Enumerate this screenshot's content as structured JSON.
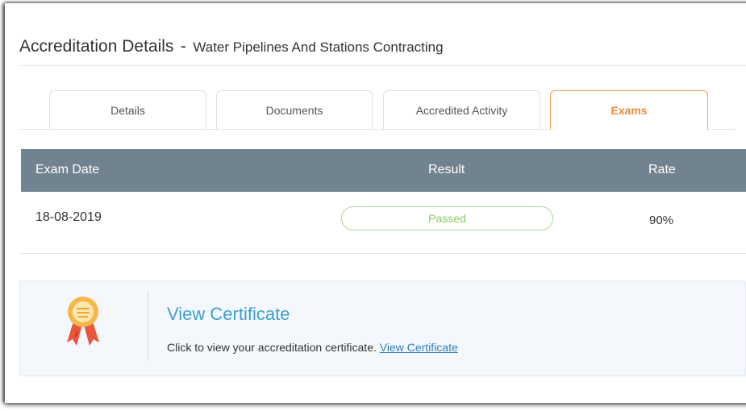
{
  "header": {
    "title": "Accreditation Details",
    "separator": "-",
    "subtitle": "Water Pipelines And Stations Contracting"
  },
  "tabs": [
    {
      "label": "Details",
      "active": false
    },
    {
      "label": "Documents",
      "active": false
    },
    {
      "label": "Accredited Activity",
      "active": false
    },
    {
      "label": "Exams",
      "active": true
    }
  ],
  "exams_table": {
    "columns": [
      "Exam Date",
      "Result",
      "Rate"
    ],
    "rows": [
      {
        "exam_date": "18-08-2019",
        "result": "Passed",
        "rate": "90%"
      }
    ]
  },
  "certificate": {
    "icon": "award-ribbon-icon",
    "title": "View Certificate",
    "description": "Click to view your accreditation certificate.",
    "link_label": "View Certificate"
  },
  "colors": {
    "accent_orange": "#ee8a3a",
    "table_header": "#71838f",
    "passed_green": "#8cc96a",
    "link_blue": "#3e9fd3"
  }
}
